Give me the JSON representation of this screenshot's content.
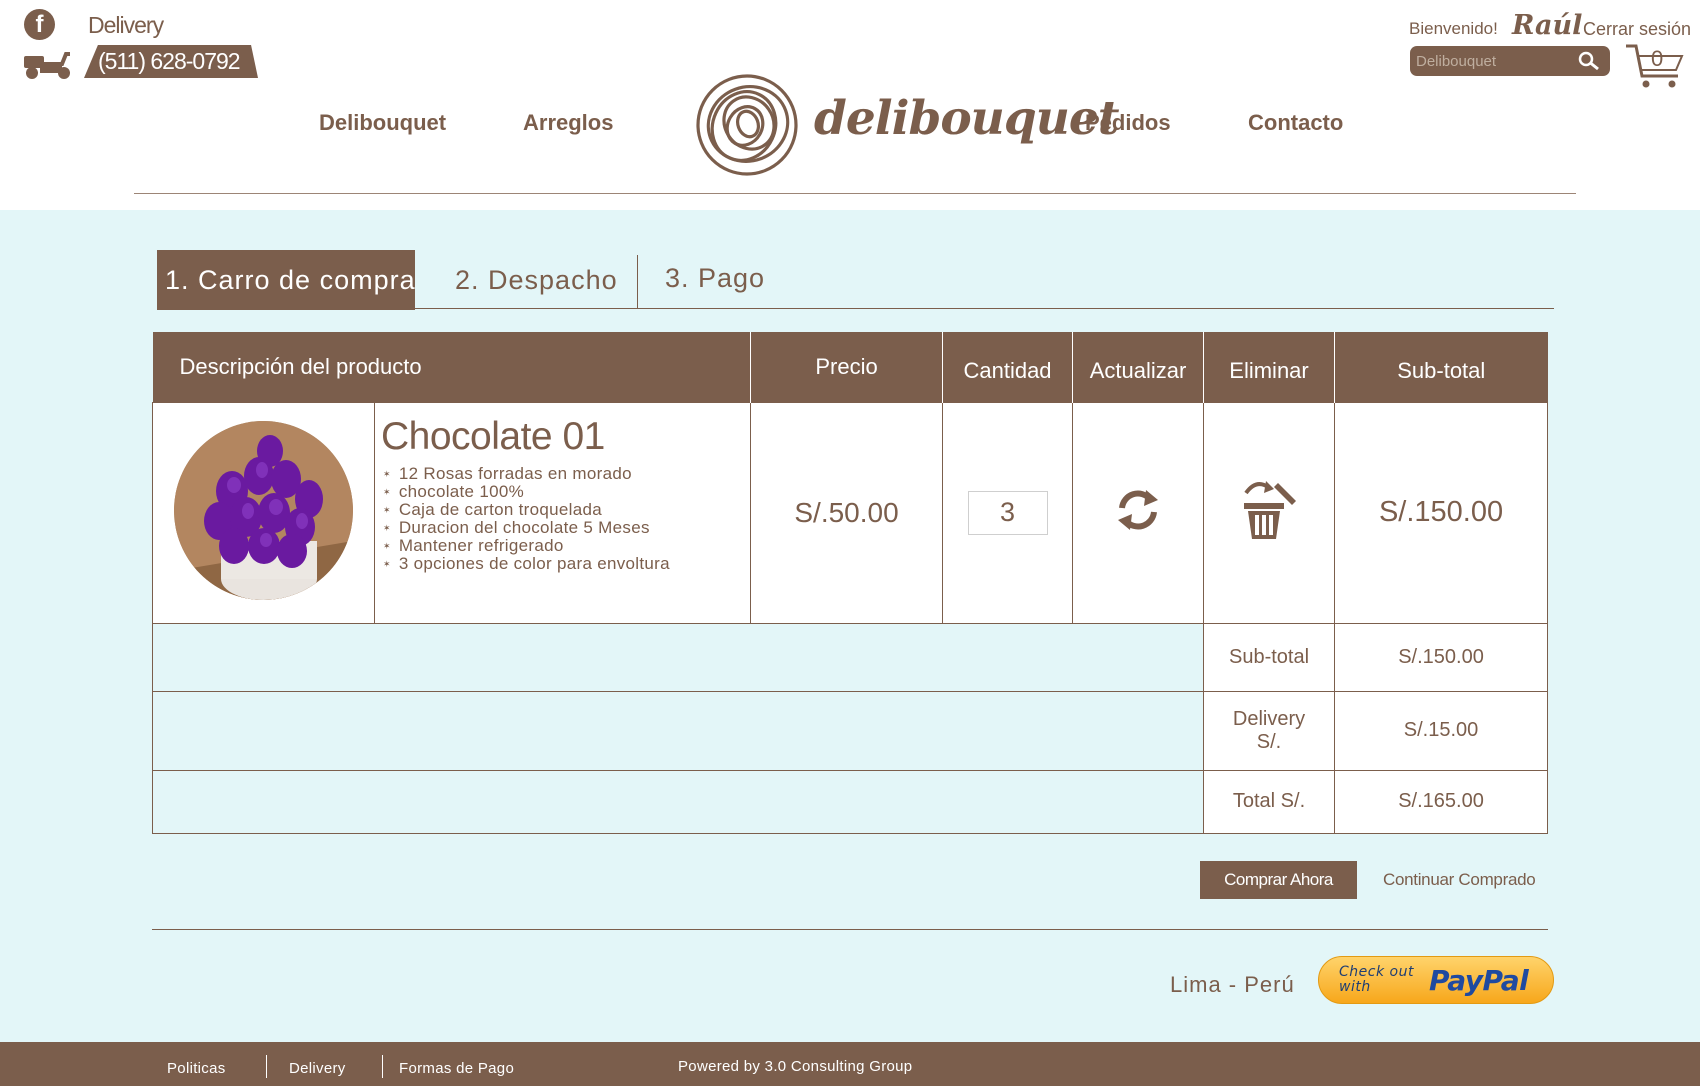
{
  "header": {
    "delivery_label": "Delivery",
    "phone": "(511) 628-0792",
    "welcome": "Bienvenido!",
    "user_name": "Raúl",
    "logout": "Cerrar sesión",
    "search_placeholder": "Delibouquet",
    "cart_count": "0",
    "nav": [
      "Delibouquet",
      "Arreglos",
      "Pedidos",
      "Contacto"
    ],
    "logo_text": "delibouquet"
  },
  "steps": [
    "1.  Carro  de  compra",
    "2.  Despacho",
    "3.  Pago"
  ],
  "table": {
    "headers": [
      "Descripción del producto",
      "Precio",
      "Cantidad",
      "Actualizar",
      "Eliminar",
      "Sub-total"
    ],
    "product": {
      "name": "Chocolate 01",
      "bullets": [
        "12 Rosas forradas en morado",
        "chocolate 100%",
        "Caja de carton troquelada",
        "Duracion del chocolate 5 Meses",
        "Mantener refrigerado",
        "3 opciones de color para envoltura"
      ],
      "price": "S/.50.00",
      "quantity": "3",
      "subtotal": "S/.150.00"
    },
    "summary": [
      {
        "label": "Sub-total",
        "value": "S/.150.00"
      },
      {
        "label": "Delivery S/.",
        "value": "S/.15.00"
      },
      {
        "label": "Total S/.",
        "value": "S/.165.00"
      }
    ]
  },
  "actions": {
    "buy": "Comprar Ahora",
    "continue": "Continuar Comprado"
  },
  "location": "Lima  -  Perú",
  "paypal": {
    "check": "Check out with",
    "brand": "PayPal"
  },
  "footer": {
    "links": [
      "Politicas",
      "Delivery",
      "Formas de Pago"
    ],
    "powered": "Powered  by  3.0  Consulting  Group"
  },
  "colors": {
    "brand": "#7b5e4c",
    "background": "#e3f6f8"
  }
}
